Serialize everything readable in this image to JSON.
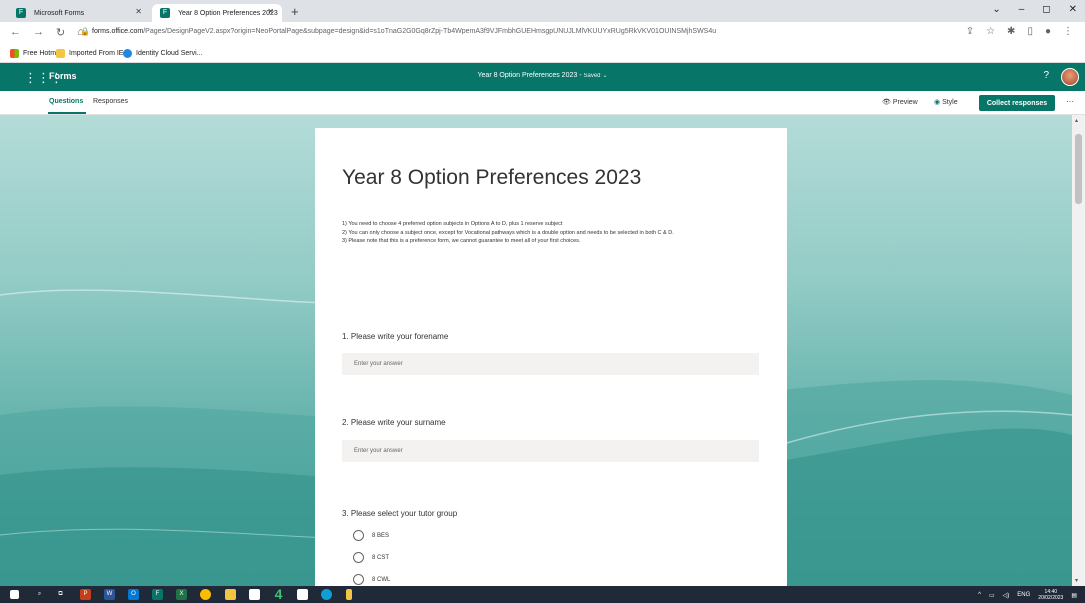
{
  "browser": {
    "tabs": [
      {
        "label": "Microsoft Forms",
        "active": false
      },
      {
        "label": "Year 8 Option Preferences 2023",
        "active": true
      }
    ],
    "url_host": "forms.office.com",
    "url_path": "/Pages/DesignPageV2.aspx?origin=NeoPortalPage&subpage=design&id=s1oTnaG2G0Gq8rZpj-Tb4WpemA3f9VJFmbhGUEHmsgpUNUJLMlVKUUYxRUg5RkVKV01OUINSMjhSWS4u",
    "bookmarks": [
      "Free Hotmail",
      "Imported From IE",
      "Identity Cloud Servi..."
    ]
  },
  "header": {
    "app_name": "Forms",
    "form_title": "Year 8 Option Preferences 2023",
    "separator": " - ",
    "saved_status": "Saved"
  },
  "toolbar": {
    "tab_questions": "Questions",
    "tab_responses": "Responses",
    "preview": "Preview",
    "style": "Style",
    "collect": "Collect responses"
  },
  "form": {
    "title": "Year 8 Option Preferences 2023",
    "description": [
      "1) You need to choose 4 preferred option subjects in Options A to D, plus 1 reserve subject",
      "2) You can only choose a subject once, except for Vocational pathways which is a double option and needs to be selected in both C & D.",
      "3) Please note that this is a preference form, we cannot guarantee to meet all of your first choices."
    ],
    "questions": [
      {
        "label": "1. Please write your forename",
        "placeholder": "Enter your answer"
      },
      {
        "label": "2. Please write your surname",
        "placeholder": "Enter your answer"
      },
      {
        "label": "3. Please select your tutor group",
        "choices": [
          "8 BES",
          "8 CST",
          "8 CWL"
        ]
      }
    ]
  },
  "taskbar": {
    "lang": "ENG",
    "time": "14:40",
    "date": "20/02/2023"
  },
  "colors": {
    "brand": "#077568",
    "tab_bar": "#dee1e6"
  }
}
